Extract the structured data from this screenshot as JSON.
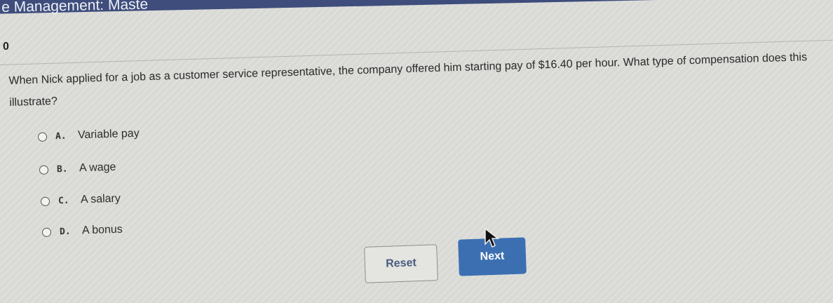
{
  "header": {
    "title": "e Management: Maste"
  },
  "question": {
    "number": "0",
    "text": "When Nick applied for a job as a customer service representative, the company offered him starting pay of $16.40 per hour. What type of compensation does this illustrate?"
  },
  "options": [
    {
      "letter": "A.",
      "text": "Variable pay"
    },
    {
      "letter": "B.",
      "text": "A wage"
    },
    {
      "letter": "C.",
      "text": "A salary"
    },
    {
      "letter": "D.",
      "text": "A bonus"
    }
  ],
  "buttons": {
    "reset_label": "Reset",
    "next_label": "Next"
  },
  "colors": {
    "header_bg": "#3e4d7c",
    "next_button_bg": "#3c6fb2",
    "reset_text": "#495b80"
  },
  "icons": {
    "cursor": "mouse-cursor-icon"
  }
}
